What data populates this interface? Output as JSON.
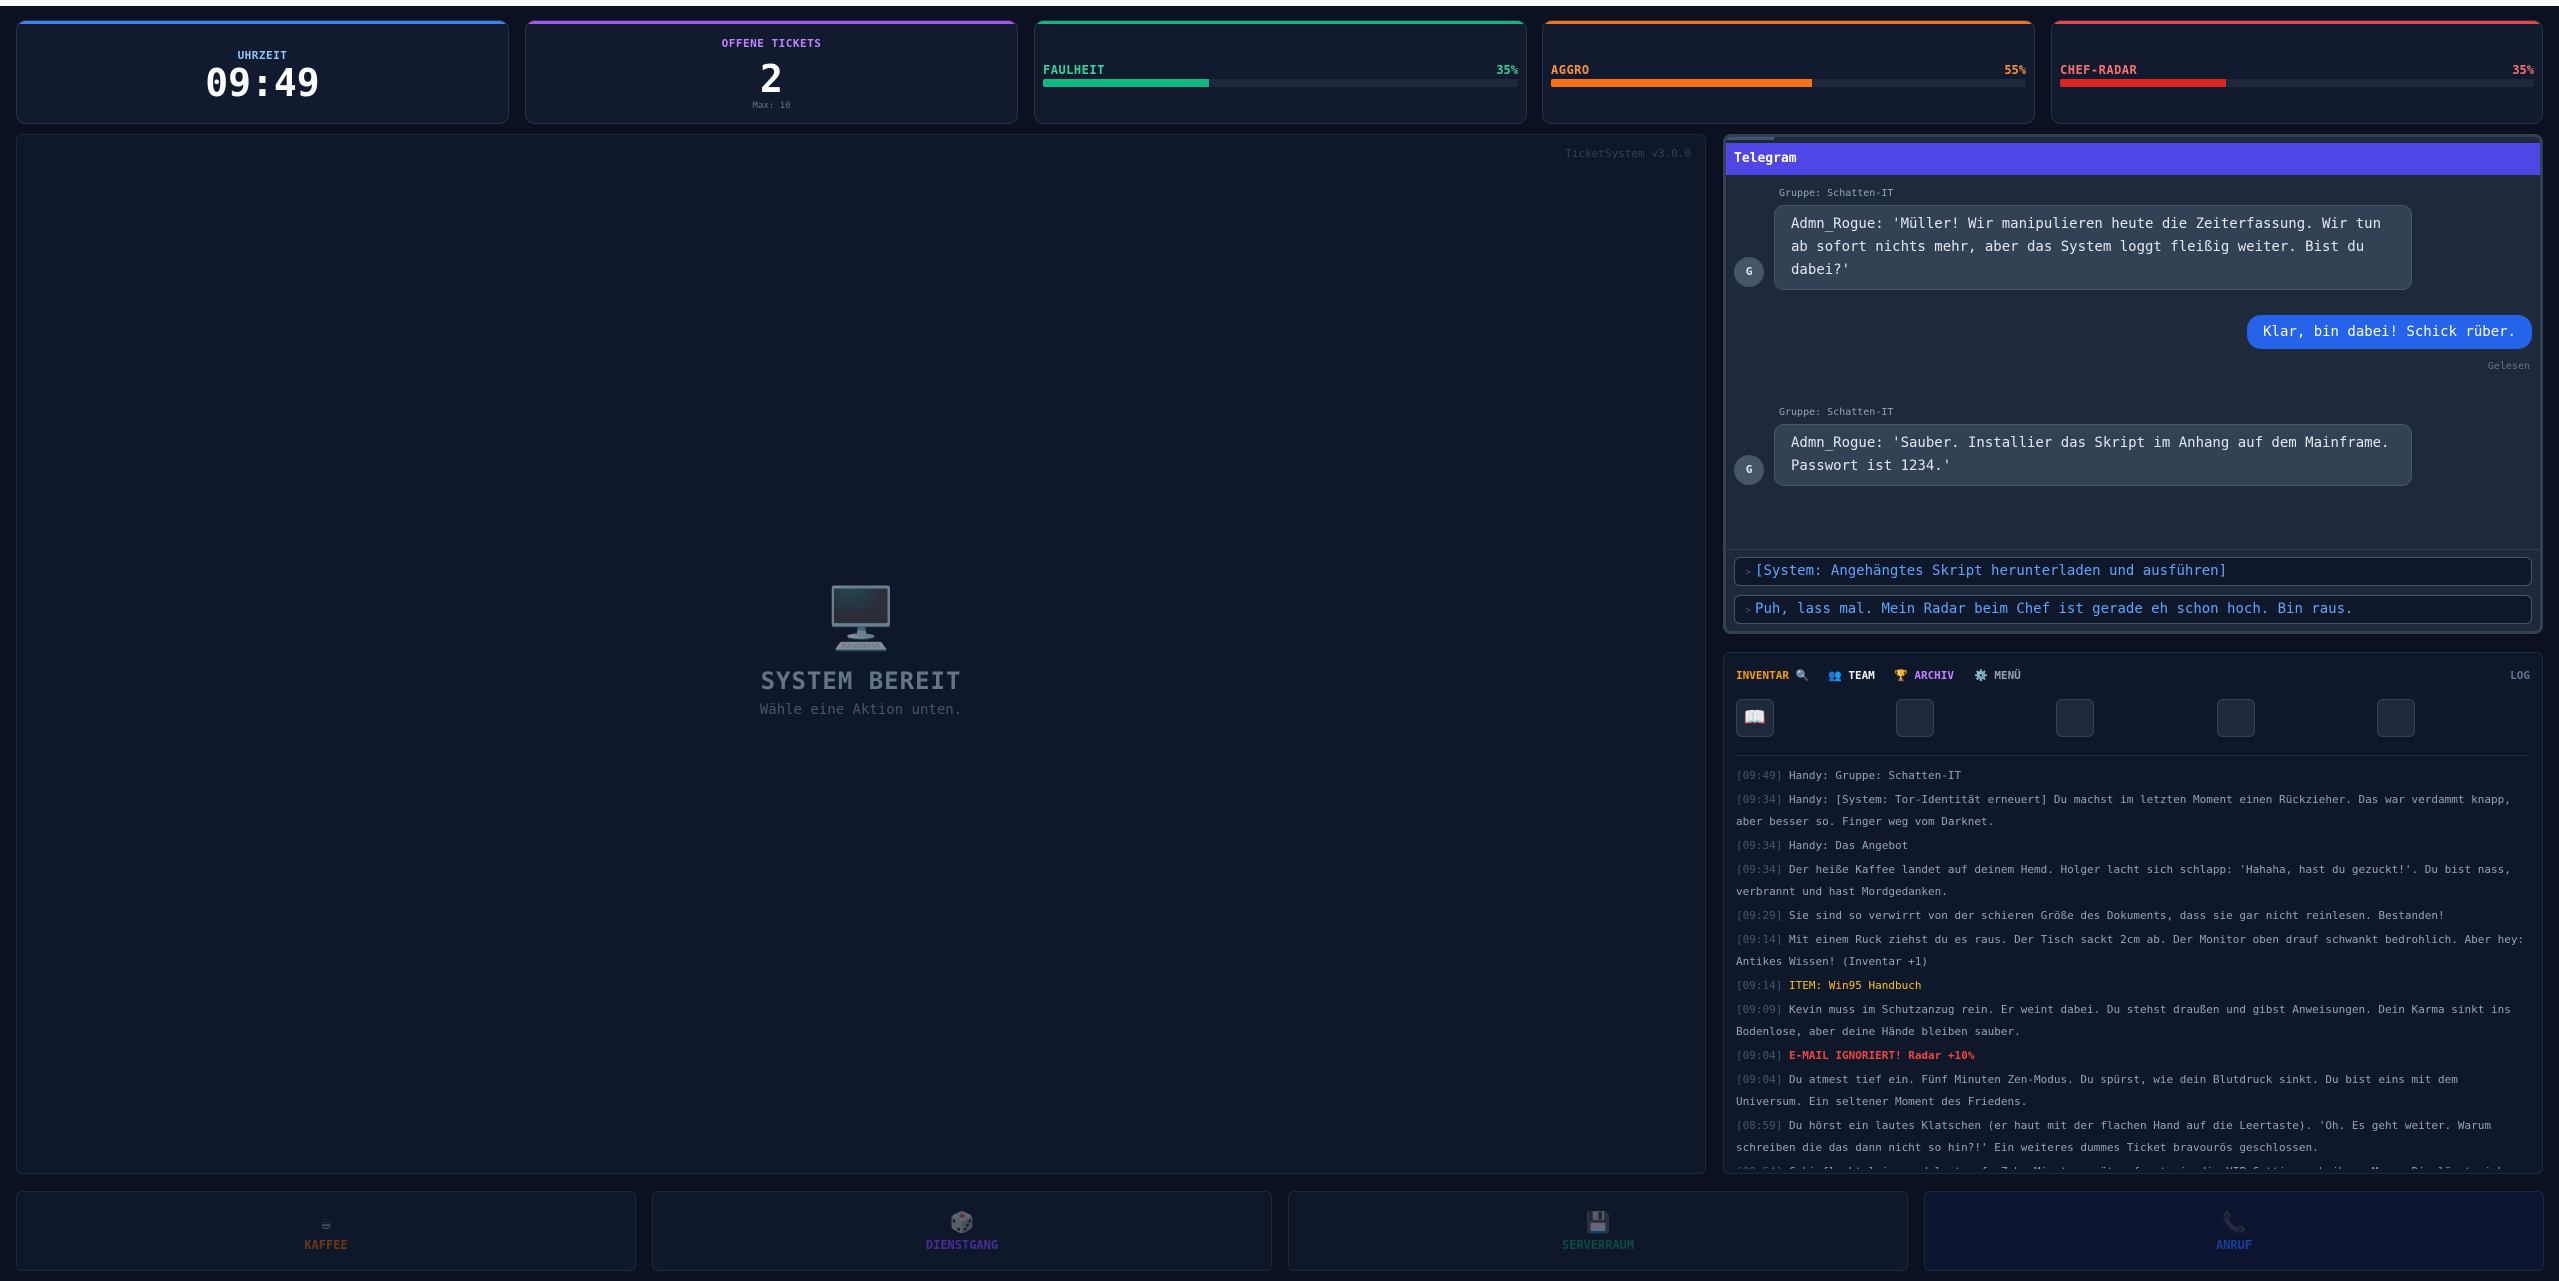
{
  "stats": {
    "clock": {
      "label": "UHRZEIT",
      "value": "09:49"
    },
    "tickets": {
      "label": "OFFENE TICKETS",
      "value": "2",
      "sub": "Max: 10"
    },
    "meters": [
      {
        "label": "FAULHEIT",
        "percent": "35%",
        "level": 0.35,
        "color": "#10b981"
      },
      {
        "label": "AGGRO",
        "percent": "55%",
        "level": 0.55,
        "color": "#f97316"
      },
      {
        "label": "CHEF-RADAR",
        "percent": "35%",
        "level": 0.35,
        "color": "#dc2626"
      }
    ],
    "accent_colors": [
      "#3b82f6",
      "#a855f7",
      "#10b981",
      "#f97316",
      "#ef4444"
    ]
  },
  "screen": {
    "version": "TicketSystem v3.0.0",
    "icon": "computer-icon",
    "title": "SYSTEM BEREIT",
    "subtitle": "Wähle eine Aktion unten."
  },
  "telegram": {
    "title": "Telegram",
    "messages": [
      {
        "group": "Gruppe: Schatten-IT",
        "avatar": "G",
        "text": "Admn_Rogue: 'Müller! Wir manipulieren heute die Zeiterfassung. Wir tun ab sofort nichts mehr, aber das System loggt fleißig weiter. Bist du dabei?'"
      },
      {
        "text": "Klar, bin dabei! Schick rüber.",
        "status": "Gelesen"
      },
      {
        "group": "Gruppe: Schatten-IT",
        "avatar": "G",
        "text": "Admn_Rogue: 'Sauber. Installier das Skript im Anhang auf dem Mainframe. Passwort ist 1234.'"
      }
    ],
    "choices": [
      {
        "arrow": ">",
        "text": "[System: Angehängtes Skript herunterladen und ausführen]"
      },
      {
        "arrow": ">",
        "text": "Puh, lass mal. Mein Radar beim Chef ist gerade eh schon hoch. Bin raus."
      }
    ]
  },
  "panel": {
    "tabs": [
      {
        "label": "INVENTAR 🔍",
        "color": "#f59e0b"
      },
      {
        "label": "👥 TEAM",
        "color": "#f1f5f9"
      },
      {
        "label": "🏆 ARCHIV",
        "color": "#c084fc"
      },
      {
        "label": "⚙️ MENÜ",
        "color": "#94a3b8"
      },
      {
        "label": "LOG",
        "color": "#64748b"
      }
    ],
    "inventory": [
      {
        "icon": "📖",
        "icon_name": "handbook-icon"
      },
      {
        "icon": ""
      },
      {
        "icon": ""
      },
      {
        "icon": ""
      },
      {
        "icon": ""
      }
    ],
    "log": [
      {
        "time": "[09:49]",
        "text": "Handy: Gruppe: Schatten-IT",
        "kind": "normal"
      },
      {
        "time": "[09:34]",
        "text": "Handy: [System: Tor-Identität erneuert] Du machst im letzten Moment einen Rückzieher. Das war verdammt knapp, aber besser so. Finger weg vom Darknet.",
        "kind": "normal"
      },
      {
        "time": "[09:34]",
        "text": "Handy: Das Angebot",
        "kind": "normal"
      },
      {
        "time": "[09:34]",
        "text": "Der heiße Kaffee landet auf deinem Hemd. Holger lacht sich schlapp: 'Hahaha, hast du gezuckt!'. Du bist nass, verbrannt und hast Mordgedanken.",
        "kind": "normal"
      },
      {
        "time": "[09:29]",
        "text": "Sie sind so verwirrt von der schieren Größe des Dokuments, dass sie gar nicht reinlesen. Bestanden!",
        "kind": "normal"
      },
      {
        "time": "[09:14]",
        "text": "Mit einem Ruck ziehst du es raus. Der Tisch sackt 2cm ab. Der Monitor oben drauf schwankt bedrohlich. Aber hey: Antikes Wissen! (Inventar +1)",
        "kind": "normal"
      },
      {
        "time": "[09:14]",
        "text": "ITEM: Win95 Handbuch",
        "kind": "item"
      },
      {
        "time": "[09:09]",
        "text": "Kevin muss im Schutzanzug rein. Er weint dabei. Du stehst draußen und gibst Anweisungen. Dein Karma sinkt ins Bodenlose, aber deine Hände bleiben sauber.",
        "kind": "normal"
      },
      {
        "time": "[09:04]",
        "text": "E-MAIL IGNORIERT! Radar +10%",
        "kind": "warn"
      },
      {
        "time": "[09:04]",
        "text": "Du atmest tief ein. Fünf Minuten Zen-Modus. Du spürst, wie dein Blutdruck sinkt. Du bist eins mit dem Universum. Ein seltener Moment des Friedens.",
        "kind": "normal"
      },
      {
        "time": "[08:59]",
        "text": "Du hörst ein lautes Klatschen (er haut mit der flachen Hand auf die Leertaste). 'Oh. Es geht weiter. Warum schreiben die das dann nicht so hin?!' Ein weiteres dummes Ticket bravourös geschlossen.",
        "kind": "normal"
      },
      {
        "time": "[08:54]",
        "text": "Gabi flucht leise und leut auf. Zehn Minuten später fragt sie die VIP-Gattin nach ihrem Mann. Die lässt sich gerade scheiden",
        "kind": "normal"
      }
    ]
  },
  "actions": [
    {
      "icon": "☕",
      "icon_name": "coffee-icon",
      "label": "KAFFEE",
      "color": "#b45309",
      "bg": "#0f172a"
    },
    {
      "icon": "🎲",
      "icon_name": "dice-icon",
      "label": "DIENSTGANG",
      "color": "#7c3aed",
      "bg": "#0f172a"
    },
    {
      "icon": "💾",
      "icon_name": "floppy-icon",
      "label": "SERVERRAUM",
      "color": "#047857",
      "bg": "#0f172a"
    },
    {
      "icon": "📞",
      "icon_name": "phone-icon",
      "label": "ANRUF",
      "color": "#2563eb",
      "bg": "#0c1430"
    }
  ]
}
